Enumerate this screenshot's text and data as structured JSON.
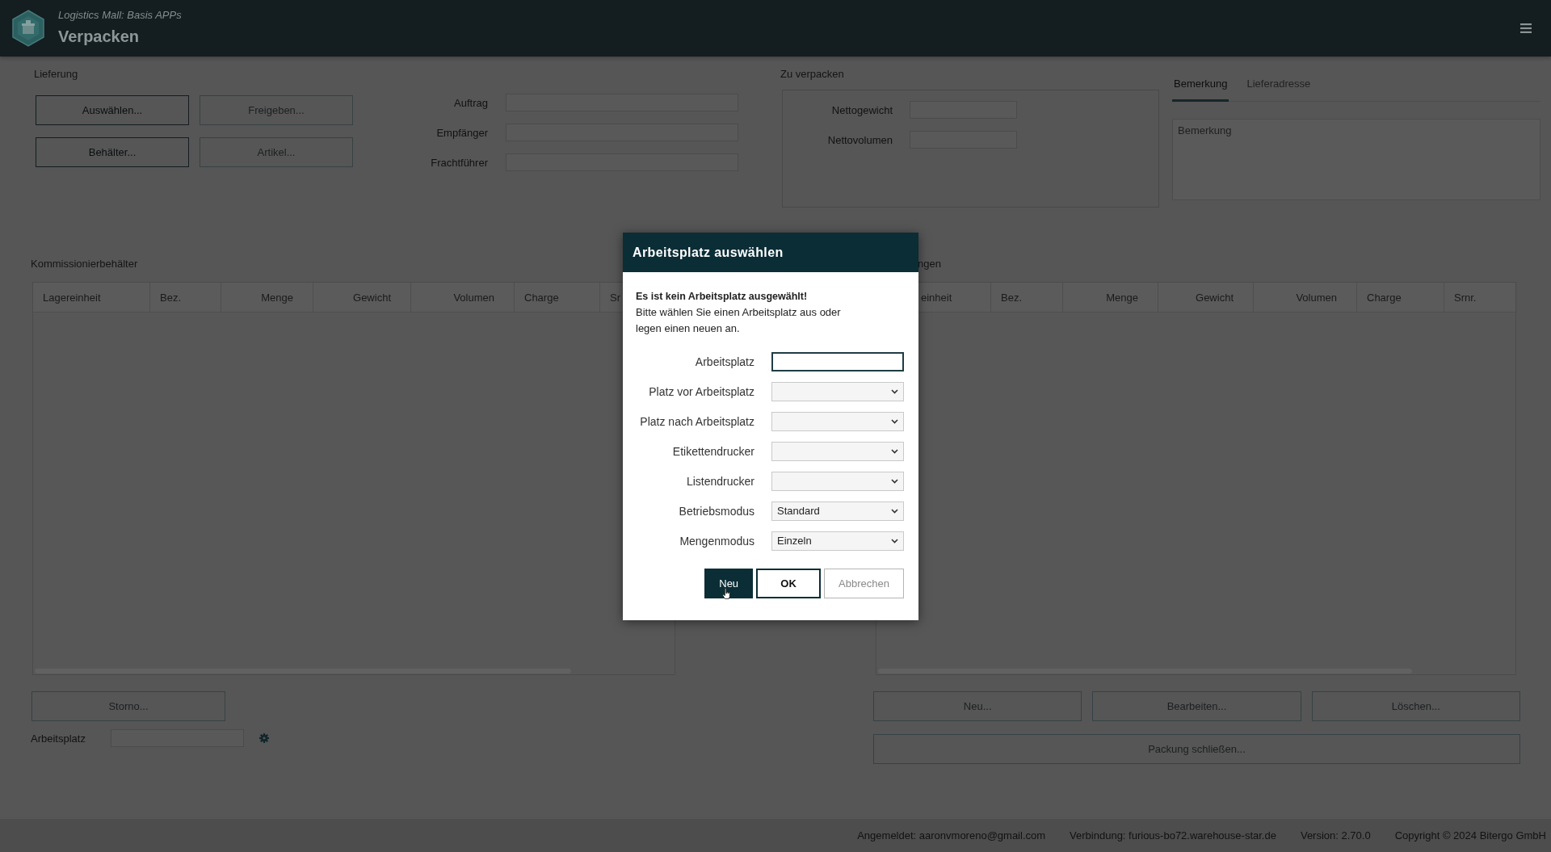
{
  "header": {
    "subtitle": "Logistics Mall: Basis APPs",
    "title": "Verpacken"
  },
  "delivery": {
    "title": "Lieferung",
    "buttons": [
      {
        "label": "Auswählen...",
        "disabled": false
      },
      {
        "label": "Freigeben...",
        "disabled": true
      },
      {
        "label": "Behälter...",
        "disabled": false
      },
      {
        "label": "Artikel...",
        "disabled": true
      }
    ],
    "fields": [
      {
        "label": "Auftrag"
      },
      {
        "label": "Empfänger"
      },
      {
        "label": "Frachtführer"
      }
    ]
  },
  "to_pack": {
    "title": "Zu verpacken",
    "fields": [
      {
        "label": "Nettogewicht"
      },
      {
        "label": "Nettovolumen"
      }
    ]
  },
  "notes": {
    "tabs": [
      {
        "label": "Bemerkung",
        "selected": true
      },
      {
        "label": "Lieferadresse",
        "selected": false
      }
    ],
    "placeholder": "Bemerkung"
  },
  "picking_containers": {
    "title": "Kommissionierbehälter",
    "columns": [
      {
        "label": "Lagereinheit",
        "kind": "text"
      },
      {
        "label": "Bez.",
        "kind": "text"
      },
      {
        "label": "Menge",
        "kind": "number"
      },
      {
        "label": "Gewicht",
        "kind": "number"
      },
      {
        "label": "Volumen",
        "kind": "number"
      },
      {
        "label": "Charge",
        "kind": "text"
      },
      {
        "label": "Sr",
        "kind": "text"
      }
    ],
    "buttons": [
      {
        "label": "Storno...",
        "disabled": true
      }
    ],
    "workplace": {
      "label": "Arbeitsplatz"
    }
  },
  "packages": {
    "title": "ngen",
    "columns": [
      {
        "label": "einheit",
        "kind": "text"
      },
      {
        "label": "Bez.",
        "kind": "text"
      },
      {
        "label": "Menge",
        "kind": "number"
      },
      {
        "label": "Gewicht",
        "kind": "number"
      },
      {
        "label": "Volumen",
        "kind": "number"
      },
      {
        "label": "Charge",
        "kind": "text"
      },
      {
        "label": "Srnr.",
        "kind": "text"
      }
    ],
    "buttons": [
      {
        "label": "Neu...",
        "disabled": true
      },
      {
        "label": "Bearbeiten...",
        "disabled": true
      },
      {
        "label": "Löschen...",
        "disabled": true
      }
    ],
    "close_button": {
      "label": "Packung schließen...",
      "disabled": true
    }
  },
  "status_bar": {
    "items": [
      "Angemeldet: aaronvmoreno@gmail.com",
      "Verbindung: furious-bo72.warehouse-star.de",
      "Version: 2.70.0",
      "Copyright © 2024 Bitergo GmbH"
    ]
  },
  "dialog": {
    "title": "Arbeitsplatz auswählen",
    "message_title": "Es ist kein Arbeitsplatz ausgewählt!",
    "message": "Bitte wählen Sie einen Arbeitsplatz aus oder legen einen neuen an.",
    "fields": [
      {
        "kind": "text",
        "label": "Arbeitsplatz",
        "focused": true
      },
      {
        "kind": "select",
        "label": "Platz vor Arbeitsplatz",
        "focused": false
      },
      {
        "kind": "select",
        "label": "Platz nach Arbeitsplatz",
        "focused": false
      },
      {
        "kind": "select",
        "label": "Etikettendrucker",
        "focused": false
      },
      {
        "kind": "select",
        "label": "Listendrucker",
        "focused": false
      },
      {
        "kind": "select",
        "label": "Betriebsmodus",
        "value": "Standard",
        "focused": false
      },
      {
        "kind": "select",
        "label": "Mengenmodus",
        "value": "Einzeln",
        "focused": false
      }
    ],
    "buttons": [
      {
        "label": "Neu",
        "kind": "primary",
        "disabled": false
      },
      {
        "label": "OK",
        "kind": "default",
        "disabled": false
      },
      {
        "label": "Abbrechen",
        "kind": "default",
        "disabled": true
      }
    ]
  }
}
